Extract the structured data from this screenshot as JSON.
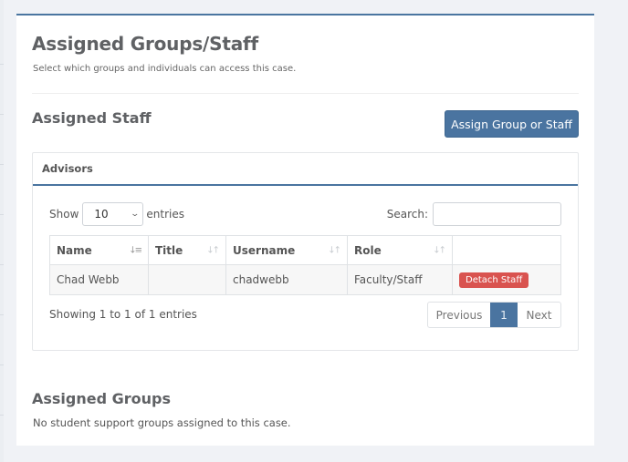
{
  "header": {
    "title": "Assigned Groups/Staff",
    "subtitle": "Select which groups and individuals can access this case."
  },
  "staff_section": {
    "title": "Assigned Staff",
    "assign_button_label": "Assign Group or Staff",
    "panel_title": "Advisors",
    "length_menu": {
      "prefix": "Show",
      "selected": "10",
      "suffix": "entries"
    },
    "search": {
      "label": "Search:",
      "value": "",
      "placeholder": ""
    },
    "table": {
      "columns": [
        {
          "label": "Name",
          "sort_icon": "sort-desc-icon"
        },
        {
          "label": "Title",
          "sort_icon": "sort-icon"
        },
        {
          "label": "Username",
          "sort_icon": "sort-icon"
        },
        {
          "label": "Role",
          "sort_icon": "sort-icon"
        },
        {
          "label": "",
          "sort_icon": ""
        }
      ],
      "rows": [
        {
          "name": "Chad Webb",
          "title": "",
          "username": "chadwebb",
          "role": "Faculty/Staff",
          "action_label": "Detach Staff"
        }
      ]
    },
    "info_text": "Showing 1 to 1 of 1 entries",
    "pagination": {
      "previous_label": "Previous",
      "current_page": "1",
      "next_label": "Next"
    }
  },
  "groups_section": {
    "title": "Assigned Groups",
    "empty_text": "No student support groups assigned to this case."
  },
  "colors": {
    "accent": "#4a74a0",
    "danger": "#d9534f",
    "background": "#f0f2f6"
  }
}
